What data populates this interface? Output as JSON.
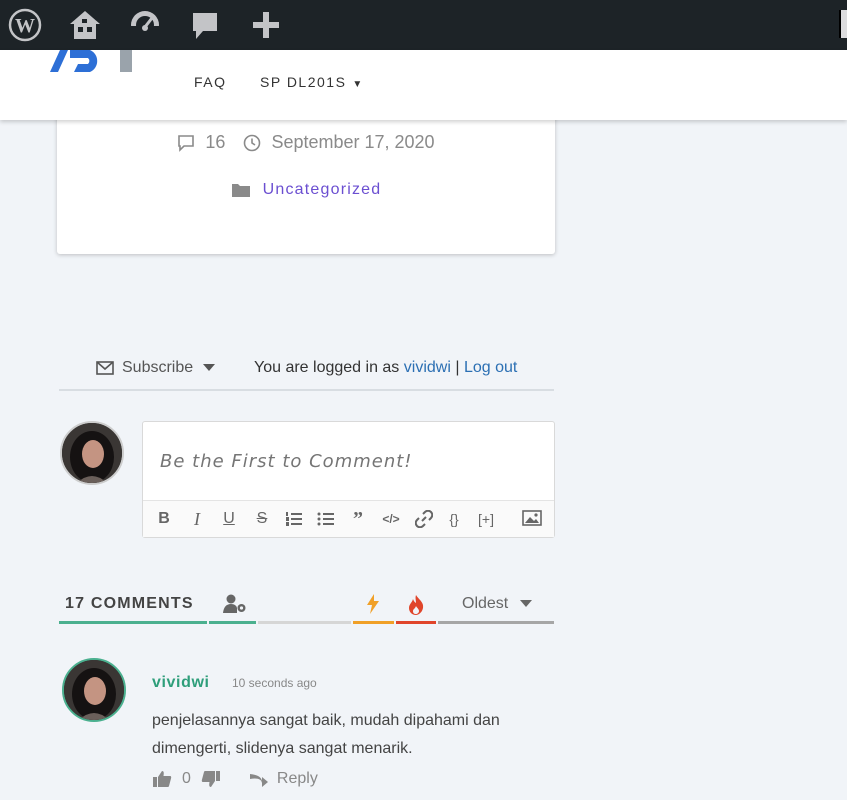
{
  "admin_bar": {
    "icons": [
      "wordpress-icon",
      "my-sites-icon",
      "dashboard-icon",
      "comments-icon",
      "new-content-icon"
    ]
  },
  "header": {
    "nav": [
      {
        "label": "FAQ"
      },
      {
        "label": "SP DL201S",
        "has_dropdown": true
      }
    ]
  },
  "post_meta": {
    "comment_count": "16",
    "date": "September 17, 2020",
    "category": "Uncategorized"
  },
  "subscribe_bar": {
    "subscribe_label": "Subscribe",
    "logged_in_prefix": "You are logged in as",
    "username": "vividwi",
    "separator": "|",
    "logout_label": "Log out"
  },
  "comment_form": {
    "placeholder": "Be the First to Comment!",
    "toolbar": [
      "bold",
      "italic",
      "underline",
      "strikethrough",
      "ordered-list",
      "unordered-list",
      "blockquote",
      "code",
      "link",
      "source-code",
      "spoiler",
      "image"
    ],
    "toolbar_text": {
      "source_code": "{}",
      "spoiler": "[+]"
    }
  },
  "comments_header": {
    "count_label": "17 COMMENTS",
    "sort_label": "Oldest",
    "colors": {
      "accent": "#4bb08f",
      "lightning": "#f0a028",
      "hot": "#e0452b"
    }
  },
  "comment": {
    "author": "vividwi",
    "time": "10 seconds ago",
    "text": "penjelasannya sangat baik, mudah dipahami dan dimengerti, slidenya sangat menarik.",
    "vote_count": "0",
    "reply_label": "Reply"
  }
}
